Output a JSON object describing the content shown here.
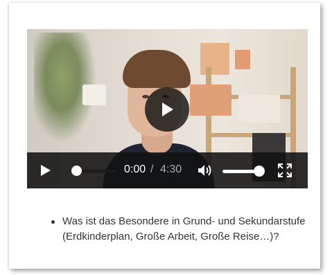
{
  "player": {
    "time_current": "0:00",
    "time_separator": "/",
    "time_total": "4:30",
    "progress": 0.0,
    "volume": 0.8,
    "icons": {
      "big_play": "play-icon",
      "play": "play-icon",
      "volume": "volume-icon",
      "fullscreen": "fullscreen-icon"
    }
  },
  "content": {
    "bullets": [
      "Was ist das Besondere in Grund- und Sekundarstufe (Erdkinderplan, Große Arbeit, Große Reise…)?"
    ]
  }
}
